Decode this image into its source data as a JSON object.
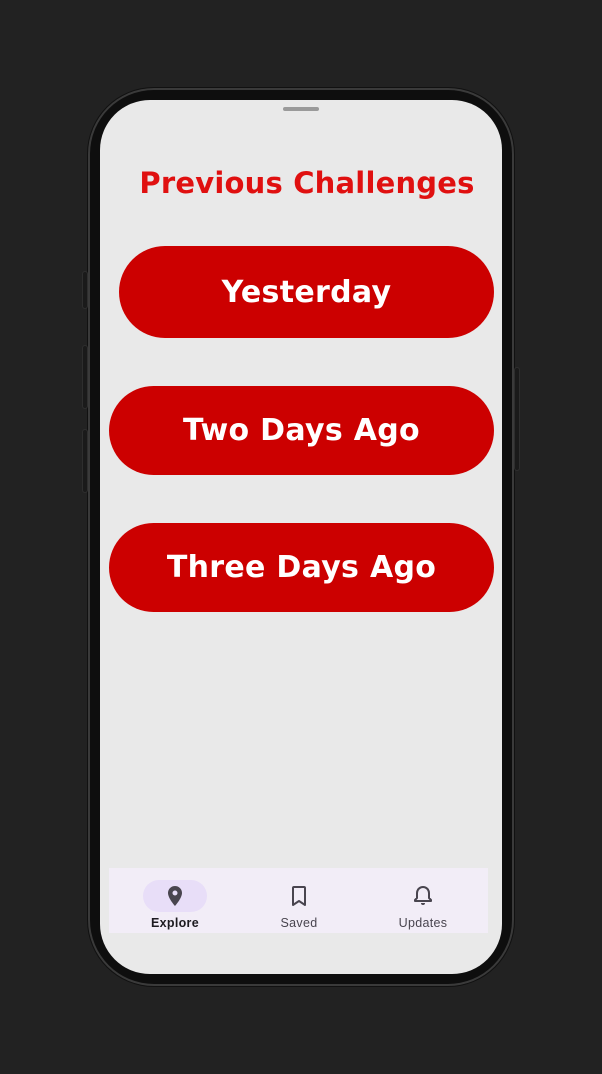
{
  "screen": {
    "title": "Previous Challenges",
    "challenges": [
      {
        "label": "Yesterday"
      },
      {
        "label": "Two Days Ago"
      },
      {
        "label": "Three Days Ago"
      }
    ]
  },
  "navbar": {
    "items": [
      {
        "label": "Explore",
        "icon": "location-pin-icon",
        "active": true
      },
      {
        "label": "Saved",
        "icon": "bookmark-icon",
        "active": false
      },
      {
        "label": "Updates",
        "icon": "bell-icon",
        "active": false
      }
    ]
  },
  "colors": {
    "accent": "#cc0000",
    "title": "#e01010",
    "screen_bg": "#e9e9e9",
    "nav_bg": "#f2edf7",
    "nav_active_indicator": "#e8def8"
  }
}
